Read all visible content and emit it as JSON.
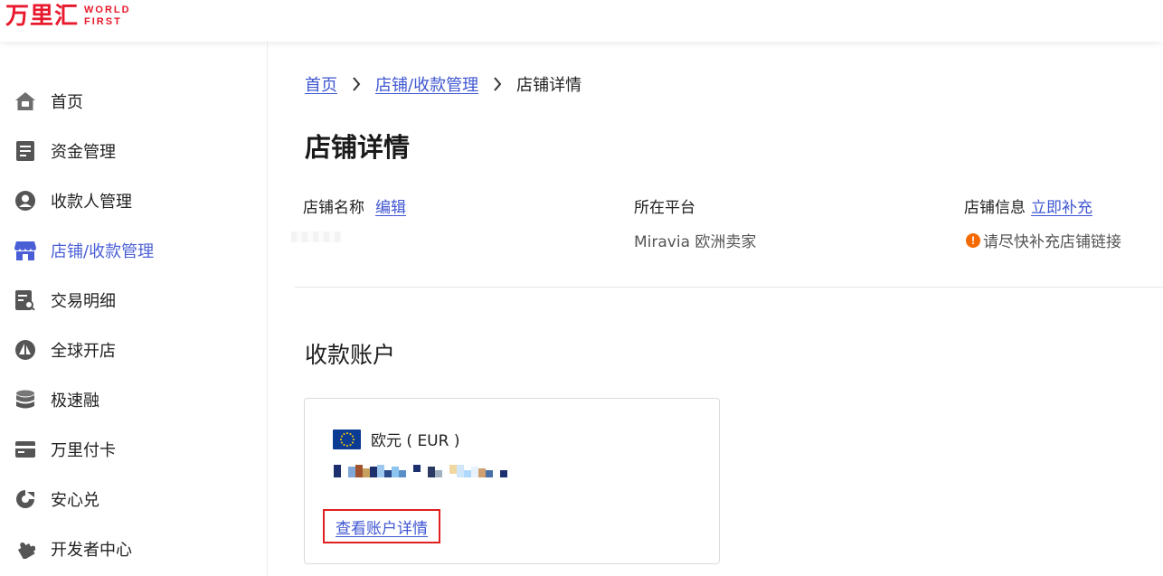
{
  "header": {
    "logo_cn": "万里汇",
    "logo_en_line1": "WORLD",
    "logo_en_line2": "FIRST"
  },
  "sidebar": {
    "items": [
      {
        "label": "首页",
        "icon": "home-icon"
      },
      {
        "label": "资金管理",
        "icon": "document-icon"
      },
      {
        "label": "收款人管理",
        "icon": "user-icon"
      },
      {
        "label": "店铺/收款管理",
        "icon": "store-icon",
        "active": true
      },
      {
        "label": "交易明细",
        "icon": "receipt-search-icon"
      },
      {
        "label": "全球开店",
        "icon": "sailboat-icon"
      },
      {
        "label": "极速融",
        "icon": "database-icon"
      },
      {
        "label": "万里付卡",
        "icon": "card-icon"
      },
      {
        "label": "安心兑",
        "icon": "exchange-icon"
      },
      {
        "label": "开发者中心",
        "icon": "puzzle-icon"
      }
    ],
    "active_color": "#4a5fd6"
  },
  "breadcrumb": {
    "home": "首页",
    "store_mgmt": "店铺/收款管理",
    "current": "店铺详情"
  },
  "page": {
    "title": "店铺详情",
    "store_name_label": "店铺名称",
    "edit_link": "编辑",
    "platform_label": "所在平台",
    "platform_value": "Miravia 欧洲卖家",
    "store_info_label": "店铺信息",
    "supplement_link": "立即补充",
    "store_info_warning": "请尽快补充店铺链接",
    "warning_mark": "!",
    "warning_color": "#f56a00"
  },
  "accounts": {
    "section_title": "收款账户",
    "cards": [
      {
        "currency_label": "欧元 ( EUR )",
        "view_details_link": "查看账户详情"
      }
    ]
  },
  "colors": {
    "link": "#3f56d1",
    "logo": "#e8192c",
    "highlight_border": "#e02020"
  }
}
